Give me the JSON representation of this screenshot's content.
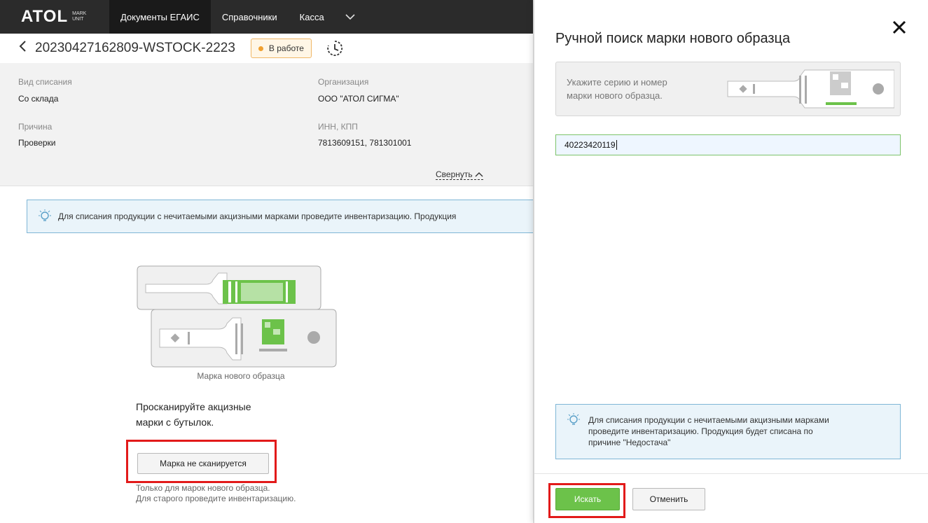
{
  "nav": {
    "brand": "ATOL",
    "brand_sub_1": "MARK",
    "brand_sub_2": "UNIT",
    "tabs": [
      "Документы ЕГАИС",
      "Справочники",
      "Касса"
    ],
    "more_icon": "chevron-down-icon"
  },
  "doc": {
    "title": "20230427162809-WSTOCK-2223",
    "status": "В работе",
    "status_color": "#f0a030"
  },
  "info": {
    "writeoff_type_label": "Вид списания",
    "writeoff_type_value": "Со склада",
    "reason_label": "Причина",
    "reason_value": "Проверки",
    "org_label": "Организация",
    "org_value": "ООО \"АТОЛ СИГМА\"",
    "inn_label": "ИНН, КПП",
    "inn_value": "7813609151, 781301001",
    "collapse_label": "Свернуть"
  },
  "main": {
    "hint": "Для списания продукции с нечитаемыми акцизными марками проведите инвентаризацию. Продукция",
    "caption": "Марка нового образца",
    "scan_line1": "Просканируйте акцизные",
    "scan_line2": "марки с бутылок.",
    "noscan_button": "Марка не сканируется",
    "note_line1": "Только для марок нового образца.",
    "note_line2": "Для старого проведите инвентаризацию."
  },
  "panel": {
    "title": "Ручной поиск марки нового образца",
    "instr_line1": "Укажите серию и номер",
    "instr_line2": "марки нового образца.",
    "input_value": "40223420119",
    "hint_line1": "Для списания продукции с нечитаемыми акцизными марками",
    "hint_line2": "проведите инвентаризацию. Продукция будет списана по",
    "hint_line3": "причине \"Недостача\"",
    "search_button": "Искать",
    "cancel_button": "Отменить",
    "accent_green": "#6cc24a",
    "highlight_red": "#e21a1a"
  }
}
